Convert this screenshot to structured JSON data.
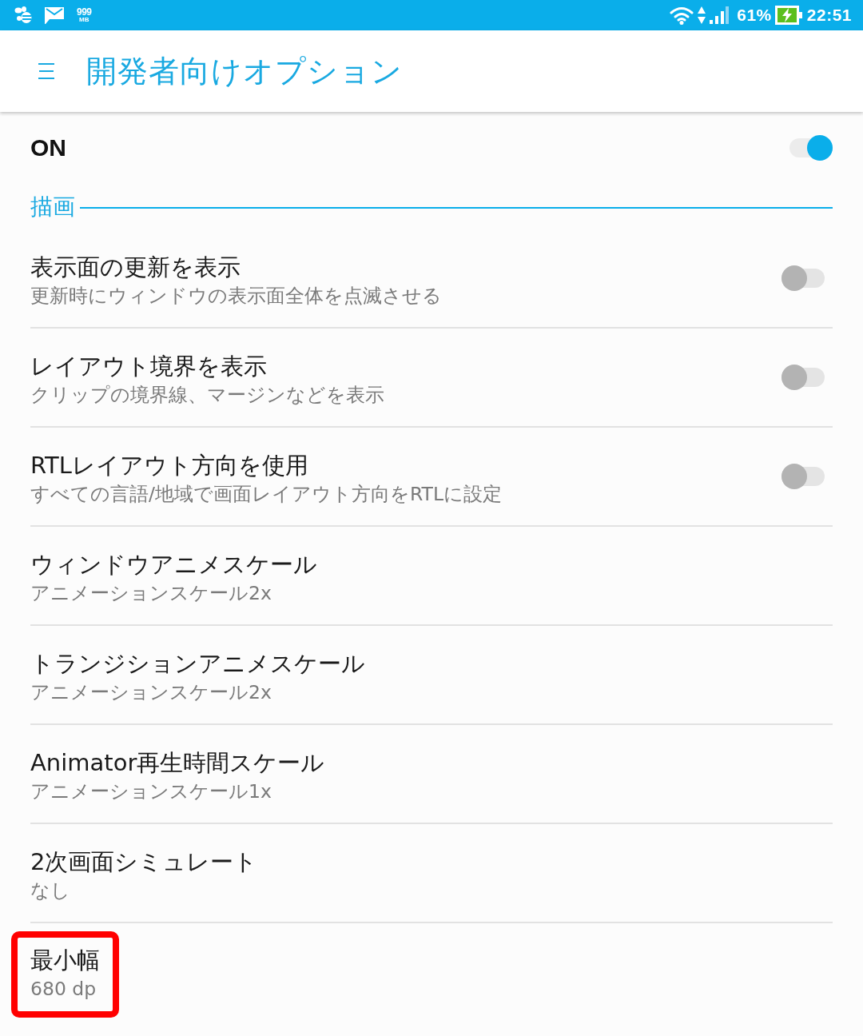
{
  "status_bar": {
    "data_usage": {
      "value": "999",
      "unit": "MB"
    },
    "battery": "61%",
    "time": "22:51"
  },
  "app_bar": {
    "title": "開発者向けオプション"
  },
  "master_switch": {
    "label": "ON",
    "on": true
  },
  "sections": [
    {
      "title": "描画",
      "items": [
        {
          "kind": "switch",
          "title": "表示面の更新を表示",
          "subtitle": "更新時にウィンドウの表示面全体を点滅させる",
          "on": false,
          "highlighted": false
        },
        {
          "kind": "switch",
          "title": "レイアウト境界を表示",
          "subtitle": "クリップの境界線、マージンなどを表示",
          "on": false,
          "highlighted": false
        },
        {
          "kind": "switch",
          "title": "RTLレイアウト方向を使用",
          "subtitle": "すべての言語/地域で画面レイアウト方向をRTLに設定",
          "on": false,
          "highlighted": false
        },
        {
          "kind": "value",
          "title": "ウィンドウアニメスケール",
          "subtitle": "アニメーションスケール2x",
          "highlighted": false
        },
        {
          "kind": "value",
          "title": "トランジションアニメスケール",
          "subtitle": "アニメーションスケール2x",
          "highlighted": false
        },
        {
          "kind": "value",
          "title": "Animator再生時間スケール",
          "subtitle": "アニメーションスケール1x",
          "highlighted": false
        },
        {
          "kind": "value",
          "title": "2次画面シミュレート",
          "subtitle": "なし",
          "highlighted": false
        },
        {
          "kind": "value",
          "title": "最小幅",
          "subtitle": "680 dp",
          "highlighted": true
        }
      ]
    }
  ]
}
